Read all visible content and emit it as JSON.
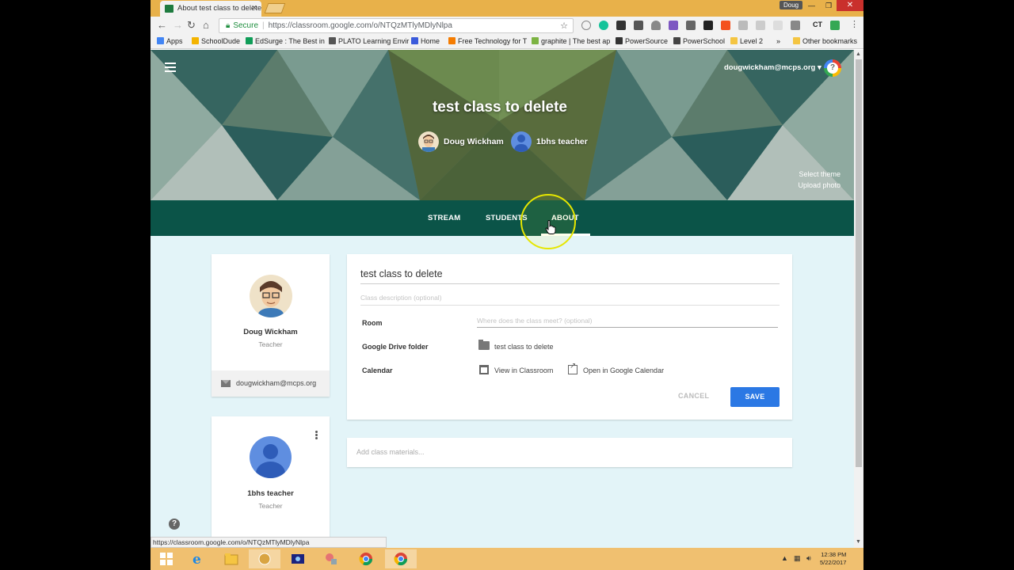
{
  "browser": {
    "tab_title": "About test class to delete",
    "tab_close": "×",
    "user_chip": "Doug",
    "url_secure": "Secure",
    "url": "https://classroom.google.com/o/NTQzMTlyMDlyNlpa",
    "status_url": "https://classroom.google.com/o/NTQzMTlyMDlyNlpa",
    "bookmarks": [
      {
        "label": "Apps",
        "color": "#4285f4"
      },
      {
        "label": "SchoolDude",
        "color": "#f4b400"
      },
      {
        "label": "EdSurge : The Best in",
        "color": "#0f9d58"
      },
      {
        "label": "PLATO Learning Envir",
        "color": "#555555"
      },
      {
        "label": "Home",
        "color": "#3b5bdb"
      },
      {
        "label": "Free Technology for T",
        "color": "#f57c00"
      },
      {
        "label": "graphite | The best ap",
        "color": "#7cb342"
      },
      {
        "label": "PowerSource",
        "color": "#333333"
      },
      {
        "label": "PowerSchool",
        "color": "#444444"
      },
      {
        "label": "Level 2",
        "color": "#f4c542"
      },
      {
        "label": "»",
        "color": ""
      },
      {
        "label": "Other bookmarks",
        "color": "#f4c542"
      }
    ]
  },
  "classroom": {
    "account": "dougwickham@mcps.org ▾",
    "class_title": "test class to delete",
    "teachers": [
      {
        "name": "Doug Wickham",
        "role": "Teacher"
      },
      {
        "name": "1bhs teacher",
        "role": "Teacher"
      }
    ],
    "select_theme": "Select theme",
    "upload_photo": "Upload photo",
    "tabs": [
      "STREAM",
      "STUDENTS",
      "ABOUT"
    ],
    "teacher_email": "dougwickham@mcps.org",
    "about": {
      "title_value": "test class to delete",
      "description_placeholder": "Class description (optional)",
      "room_label": "Room",
      "room_placeholder": "Where does the class meet? (optional)",
      "drive_label": "Google Drive folder",
      "drive_value": "test class to delete",
      "calendar_label": "Calendar",
      "view_in_classroom": "View in Classroom",
      "open_in_calendar": "Open in Google Calendar",
      "cancel": "CANCEL",
      "save": "SAVE"
    },
    "add_materials": "Add class materials...",
    "help": "?"
  },
  "taskbar": {
    "time": "12:38 PM",
    "date": "5/22/2017"
  },
  "colors": {
    "tab_bar": "#0b5448",
    "page_bg": "#e3f4f8",
    "save_button": "#2b78e4",
    "taskbar": "#f0c070",
    "chrome_titlebar": "#e8b14a"
  }
}
